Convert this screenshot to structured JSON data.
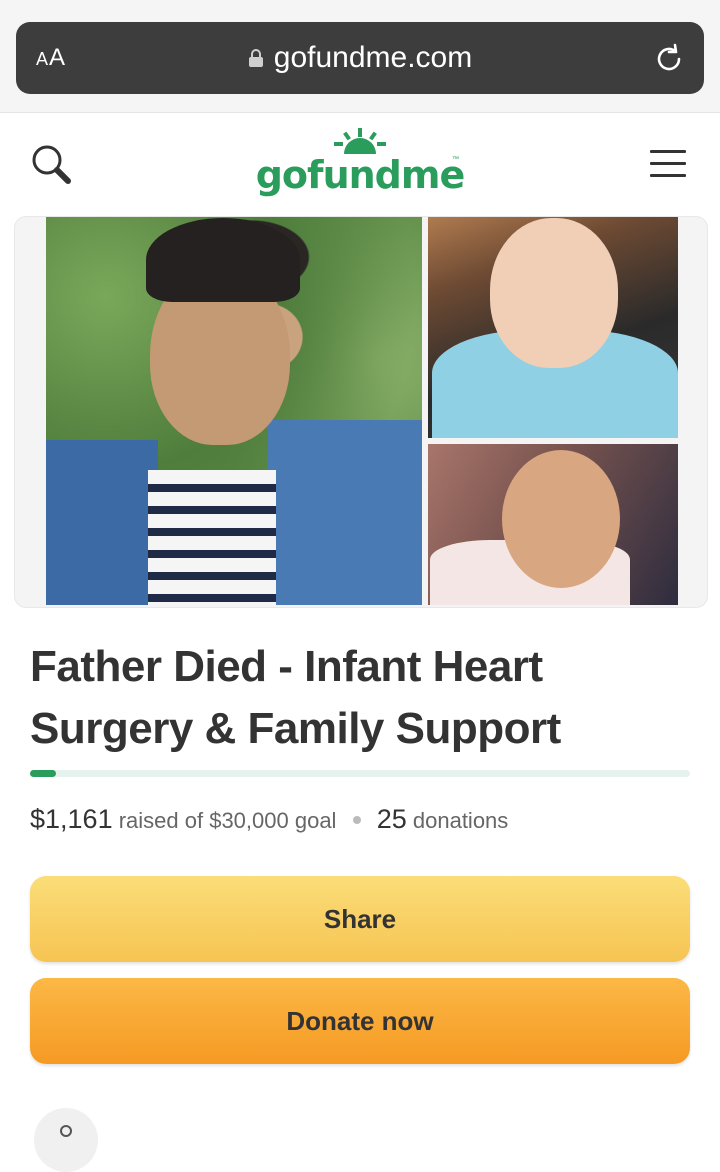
{
  "browser": {
    "text_size_label_small": "A",
    "text_size_label_large": "A",
    "url": "gofundme.com",
    "icons": {
      "lock": "lock-icon",
      "reload": "reload-icon"
    }
  },
  "header": {
    "logo_text": "gofundme",
    "logo_tm": "™",
    "icons": {
      "search": "search-icon",
      "menu": "hamburger-menu-icon"
    }
  },
  "campaign": {
    "title": "Father Died - Infant Heart Surgery & Family Support",
    "raised": "$1,161",
    "raised_of_text": "raised of $30,000 goal",
    "donations_count": "25",
    "donations_label": "donations",
    "progress_fraction": 0.0387
  },
  "actions": {
    "share_label": "Share",
    "donate_label": "Donate now"
  },
  "colors": {
    "brand_green": "#2a9d5c",
    "share_yellow": "#f6c452",
    "donate_orange": "#f59a24",
    "browser_bar": "#3d3d3d"
  }
}
